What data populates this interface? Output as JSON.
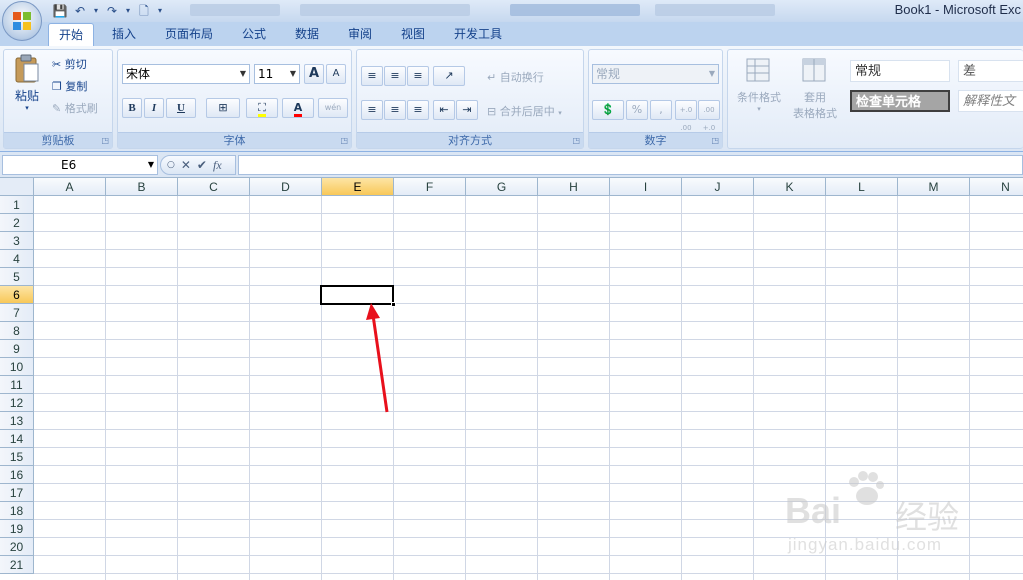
{
  "window": {
    "title": "Book1 - Microsoft Exc"
  },
  "tabs": [
    {
      "label": "开始",
      "active": true
    },
    {
      "label": "插入"
    },
    {
      "label": "页面布局"
    },
    {
      "label": "公式"
    },
    {
      "label": "数据"
    },
    {
      "label": "审阅"
    },
    {
      "label": "视图"
    },
    {
      "label": "开发工具"
    }
  ],
  "ribbon": {
    "clipboard": {
      "label": "剪贴板",
      "paste": "粘贴",
      "cut": "剪切",
      "copy": "复制",
      "format_painter": "格式刷"
    },
    "font": {
      "label": "字体",
      "name": "宋体",
      "size": "11",
      "bold": "B",
      "italic": "I",
      "underline": "U",
      "grow": "A",
      "shrink": "A",
      "font_color": "A",
      "phonetic": "wén"
    },
    "alignment": {
      "label": "对齐方式",
      "wrap_text": "自动换行",
      "merge_center": "合并后居中"
    },
    "number": {
      "label": "数字",
      "format": "常规",
      "percent": "%",
      "comma": ",",
      "inc_decimal": "+.0 .00",
      "dec_decimal": ".00 +.0"
    },
    "styles": {
      "conditional_format": "条件格式",
      "table_format_1": "套用",
      "table_format_2": "表格格式",
      "style_normal": "常规",
      "style_bad": "差",
      "style_check_cell": "检查单元格",
      "style_explanatory": "解释性文"
    }
  },
  "formula_bar": {
    "name_box": "E6",
    "fx": "fx",
    "formula": ""
  },
  "grid": {
    "columns": [
      "A",
      "B",
      "C",
      "D",
      "E",
      "F",
      "G",
      "H",
      "I",
      "J",
      "K",
      "L",
      "M",
      "N"
    ],
    "rows": [
      "1",
      "2",
      "3",
      "4",
      "5",
      "6",
      "7",
      "8",
      "9",
      "10",
      "11",
      "12",
      "13",
      "14",
      "15",
      "16",
      "17",
      "18",
      "19",
      "20",
      "21"
    ],
    "selected_column": "E",
    "selected_row": "6"
  },
  "watermark": {
    "brand": "Bai",
    "cn": "经验",
    "url": "jingyan.baidu.com"
  },
  "colors": {
    "annotation_arrow": "#e8101c",
    "selected_header": "#f8c859",
    "ribbon_text": "#15428b"
  }
}
